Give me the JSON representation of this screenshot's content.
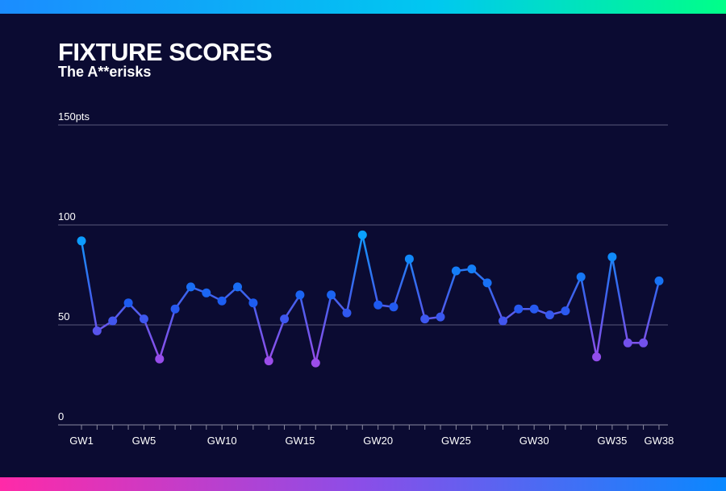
{
  "header": {
    "title": "FIXTURE SCORES",
    "subtitle": "The A**erisks"
  },
  "colors": {
    "background": "#0b0b32",
    "high": "#0aa2ff",
    "low": "#9b4dea",
    "grid": "#5a5a7a"
  },
  "chart_data": {
    "type": "line",
    "title": "FIXTURE SCORES",
    "subtitle": "The A**erisks",
    "xlabel": "",
    "ylabel": "",
    "ylim": [
      0,
      150
    ],
    "y_ticks": [
      {
        "value": 0,
        "label": "0"
      },
      {
        "value": 50,
        "label": "50"
      },
      {
        "value": 100,
        "label": "100"
      },
      {
        "value": 150,
        "label": "150pts"
      }
    ],
    "x_ticks": [
      {
        "gw": 1,
        "label": "GW1"
      },
      {
        "gw": 5,
        "label": "GW5"
      },
      {
        "gw": 10,
        "label": "GW10"
      },
      {
        "gw": 15,
        "label": "GW15"
      },
      {
        "gw": 20,
        "label": "GW20"
      },
      {
        "gw": 25,
        "label": "GW25"
      },
      {
        "gw": 30,
        "label": "GW30"
      },
      {
        "gw": 35,
        "label": "GW35"
      },
      {
        "gw": 38,
        "label": "GW38"
      }
    ],
    "x": [
      1,
      2,
      3,
      4,
      5,
      6,
      7,
      8,
      9,
      10,
      11,
      12,
      13,
      14,
      15,
      16,
      17,
      18,
      19,
      20,
      21,
      22,
      23,
      24,
      25,
      26,
      27,
      28,
      29,
      30,
      31,
      32,
      33,
      34,
      35,
      36,
      37,
      38
    ],
    "values": [
      92,
      47,
      52,
      61,
      53,
      33,
      58,
      69,
      66,
      62,
      69,
      61,
      32,
      53,
      65,
      31,
      65,
      56,
      95,
      60,
      59,
      83,
      53,
      54,
      77,
      78,
      71,
      52,
      58,
      58,
      55,
      57,
      74,
      34,
      84,
      41,
      41,
      72
    ],
    "grid": true,
    "legend": "none"
  }
}
